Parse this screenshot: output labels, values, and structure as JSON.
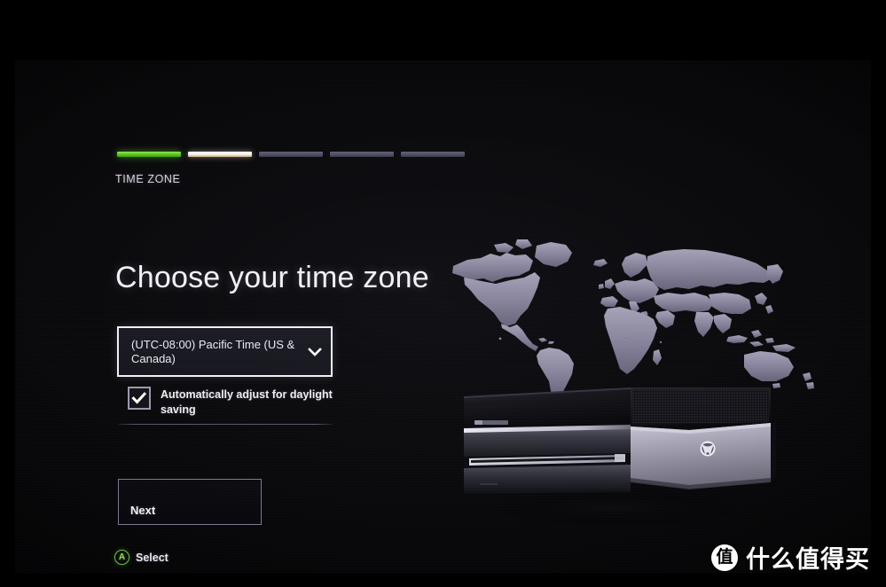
{
  "screen": {
    "step_label": "TIME ZONE",
    "heading": "Choose your time zone",
    "progress": {
      "segments": [
        {
          "state": "done"
        },
        {
          "state": "current"
        },
        {
          "state": "todo"
        },
        {
          "state": "todo"
        },
        {
          "state": "todo"
        }
      ],
      "accent_done": "#6ec82e",
      "accent_current": "#ffffff",
      "accent_todo": "#5a5a72"
    },
    "timezone_select": {
      "value": "(UTC-08:00) Pacific Time (US & Canada)",
      "chevron_icon": "chevron-down-icon"
    },
    "daylight_saving": {
      "label": "Automatically adjust for daylight saving",
      "checked": true,
      "check_icon": "checkmark-icon"
    },
    "next_button": {
      "label": "Next"
    },
    "legend": {
      "button_glyph": "A",
      "action_label": "Select"
    },
    "artwork": {
      "world_map_alt": "world-map-graphic",
      "console_alt": "xbox-one-console-graphic",
      "console_logo": "xbox-logo-icon"
    }
  },
  "watermark": {
    "badge_glyph": "值",
    "text": "什么值得买"
  }
}
